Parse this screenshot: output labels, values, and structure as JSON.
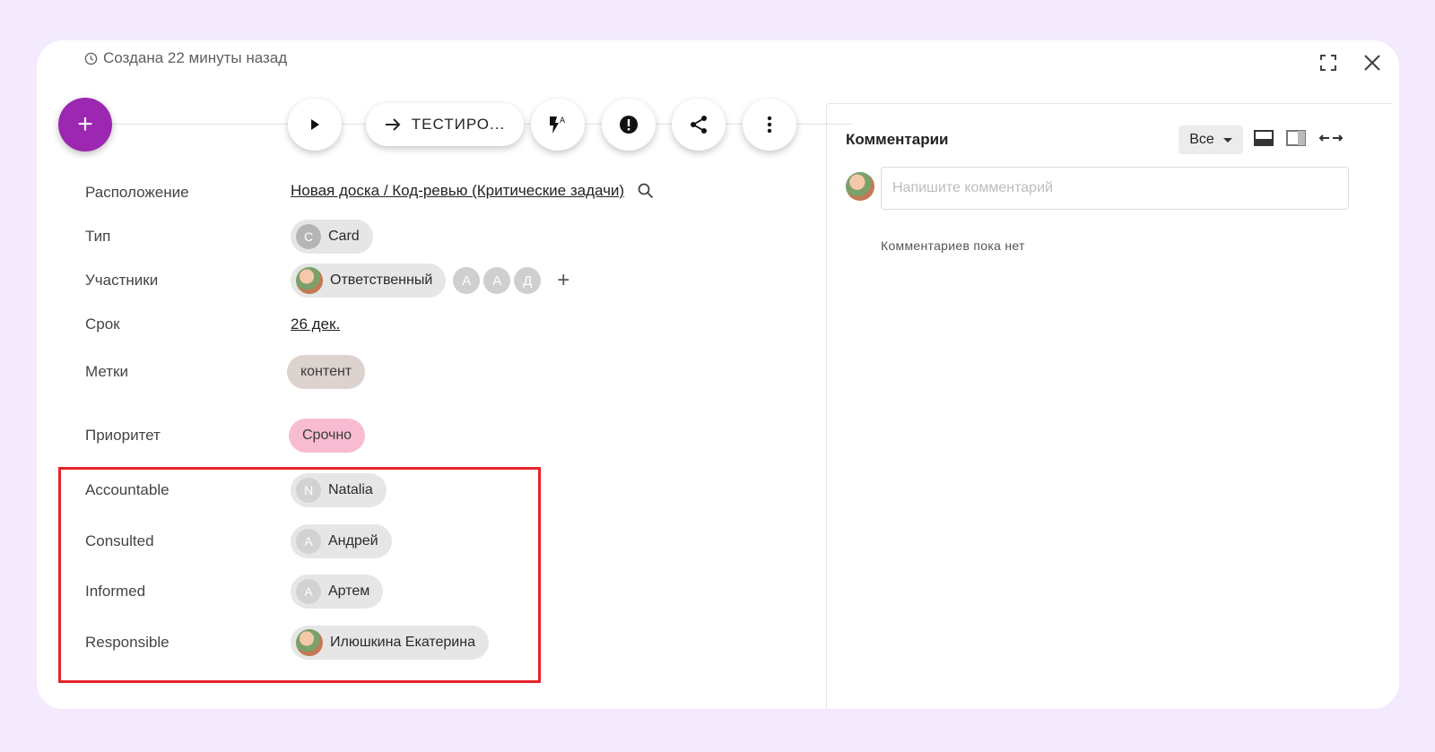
{
  "header": {
    "created_text": "Создана 22 минуты назад"
  },
  "toolbar": {
    "status_label": "ТЕСТИРО..."
  },
  "fields": {
    "location": {
      "label": "Расположение",
      "value": "Новая доска / Код-ревью (Критические задачи)"
    },
    "type": {
      "label": "Тип",
      "letter": "C",
      "value": "Card"
    },
    "participants": {
      "label": "Участники",
      "responsible": "Ответственный",
      "others": [
        "А",
        "А",
        "Д"
      ]
    },
    "due": {
      "label": "Срок",
      "value": "26 дек."
    },
    "tags": {
      "label": "Метки",
      "value": "контент"
    },
    "priority": {
      "label": "Приоритет",
      "value": "Срочно"
    }
  },
  "raci": [
    {
      "label": "Accountable",
      "letter": "N",
      "name": "Natalia"
    },
    {
      "label": "Consulted",
      "letter": "А",
      "name": "Андрей"
    },
    {
      "label": "Informed",
      "letter": "А",
      "name": "Артем"
    },
    {
      "label": "Responsible",
      "letter": "",
      "name": "Илюшкина Екатерина"
    }
  ],
  "comments": {
    "title": "Комментарии",
    "filter_value": "Все",
    "input_placeholder": "Напишите комментарий",
    "empty_text": "Комментариев пока нет"
  },
  "colors": {
    "accent": "#9c27b0",
    "priority_chip": "#f8bcd2",
    "tag_chip": "#dcd2ce",
    "highlight": "#e8242b",
    "background": "#f3ebfd"
  }
}
